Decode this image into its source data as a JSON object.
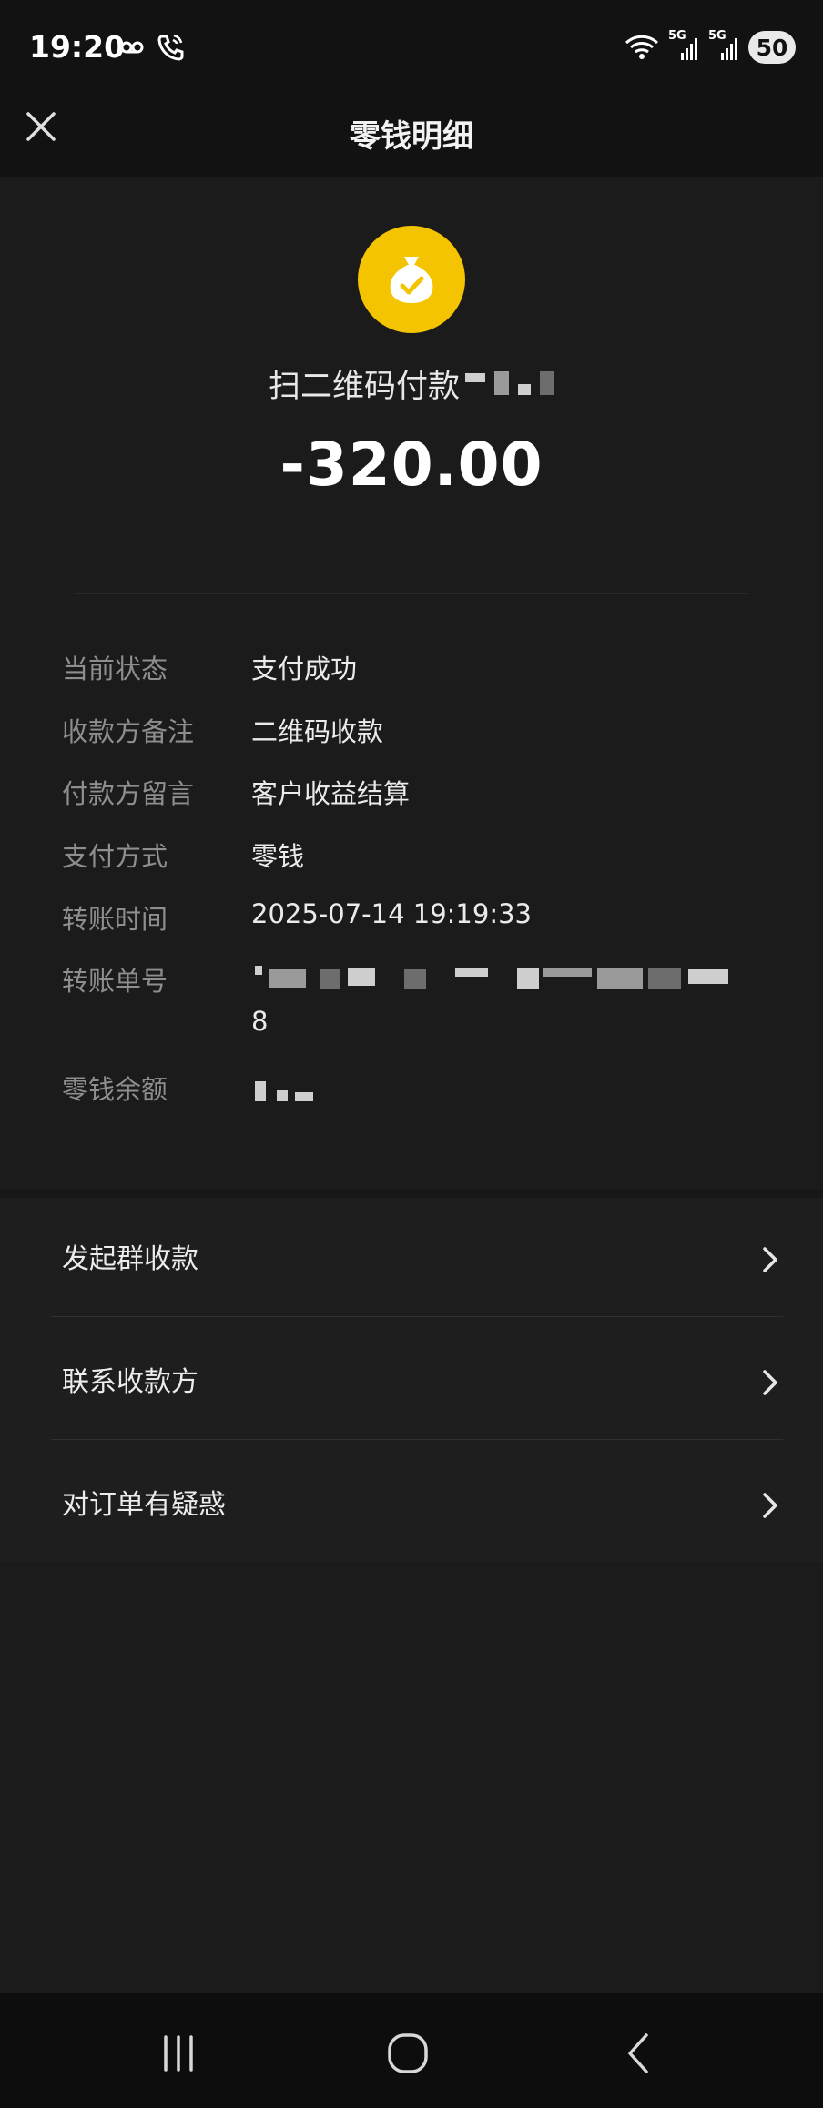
{
  "status_bar": {
    "time": "19:20",
    "battery": "50",
    "network_labels": [
      "5G",
      "5G"
    ],
    "icons": [
      "voicemail-icon",
      "wifi-call-icon",
      "wifi-icon",
      "signal-5g-icon",
      "signal-5g-icon",
      "battery-icon"
    ]
  },
  "header": {
    "title": "零钱明细",
    "close_icon": "close-icon"
  },
  "summary": {
    "icon": "money-bag-check-icon",
    "icon_color": "#f5c400",
    "merchant": "扫二维码付款",
    "amount": "-320.00"
  },
  "details": [
    {
      "label": "当前状态",
      "value": "支付成功"
    },
    {
      "label": "收款方备注",
      "value": "二维码收款"
    },
    {
      "label": "付款方留言",
      "value": "客户收益结算"
    },
    {
      "label": "支付方式",
      "value": "零钱"
    },
    {
      "label": "转账时间",
      "value": "2025-07-14 19:19:33"
    },
    {
      "label": "转账单号",
      "value": "8"
    },
    {
      "label": "零钱余额",
      "value": ""
    }
  ],
  "actions": [
    {
      "label": "发起群收款",
      "icon": "chevron-right-icon"
    },
    {
      "label": "联系收款方",
      "icon": "chevron-right-icon"
    },
    {
      "label": "对订单有疑惑",
      "icon": "chevron-right-icon"
    }
  ],
  "nav": {
    "icons": [
      "recent-apps-icon",
      "home-icon",
      "back-icon"
    ]
  }
}
